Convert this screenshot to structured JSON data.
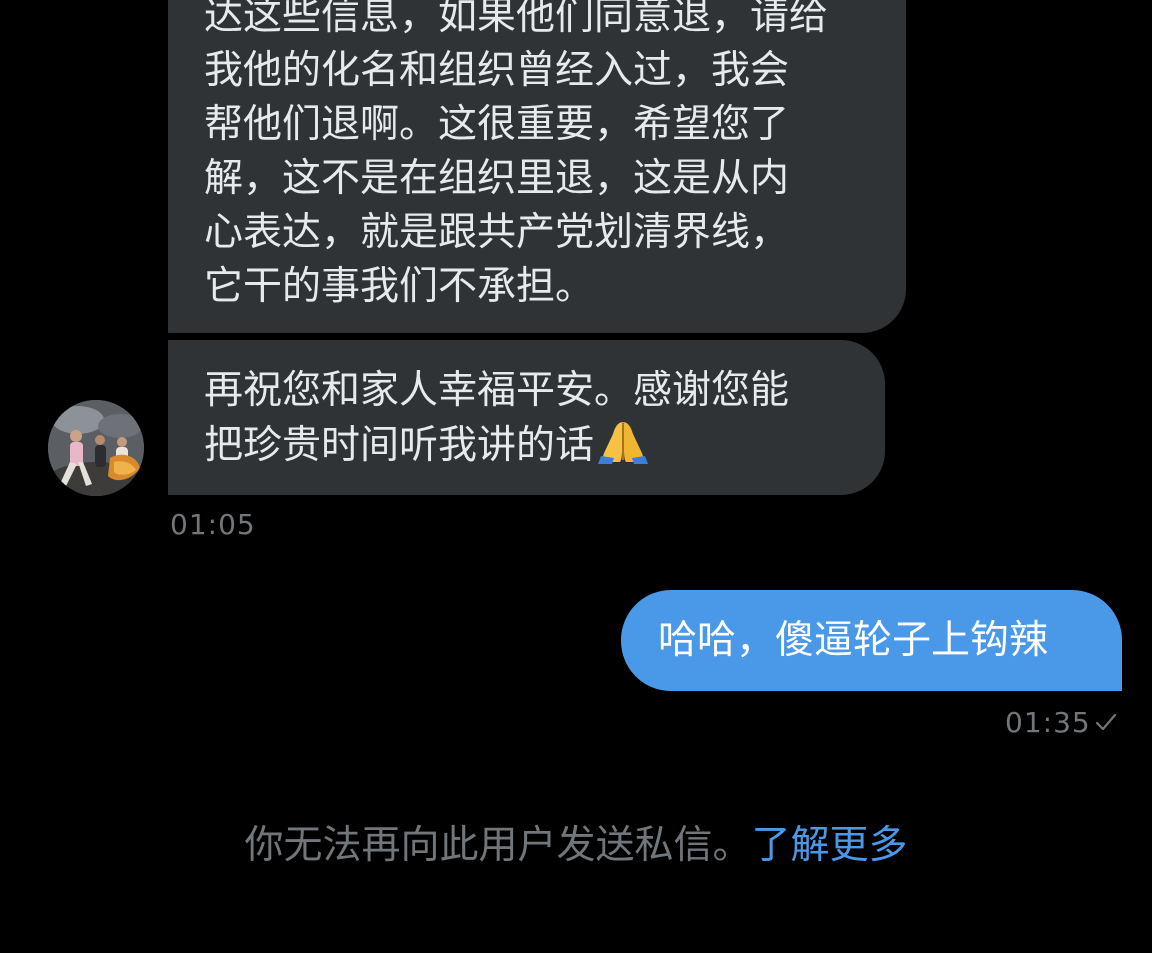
{
  "conversation": {
    "incoming_message_1": {
      "lines": [
        "达这些信息，如果他们同意退，请给",
        "我他的化名和组织曾经入过，我会",
        "帮他们退啊。这很重要，希望您了",
        "解，这不是在组织里退，这是从内",
        "心表达，就是跟共产党划清界线，",
        "它干的事我们不承担。"
      ]
    },
    "incoming_message_2": {
      "lines": [
        "再祝您和家人幸福平安。感谢您能",
        "把珍贵时间听我讲的话"
      ],
      "trailing_icon": "folded-hands-emoji"
    },
    "incoming_timestamp": "01:05",
    "outgoing_message": {
      "text": "哈哈，傻逼轮子上钩辣"
    },
    "outgoing_timestamp": "01:35",
    "outgoing_status_icon": "check-icon"
  },
  "footer": {
    "notice_text": "你无法再向此用户发送私信。",
    "learn_more_label": "了解更多"
  },
  "colors": {
    "background": "#000000",
    "incoming_bubble": "#2f3336",
    "outgoing_bubble": "#4a99e9",
    "link": "#4a99e9",
    "muted_text": "#71767b"
  }
}
